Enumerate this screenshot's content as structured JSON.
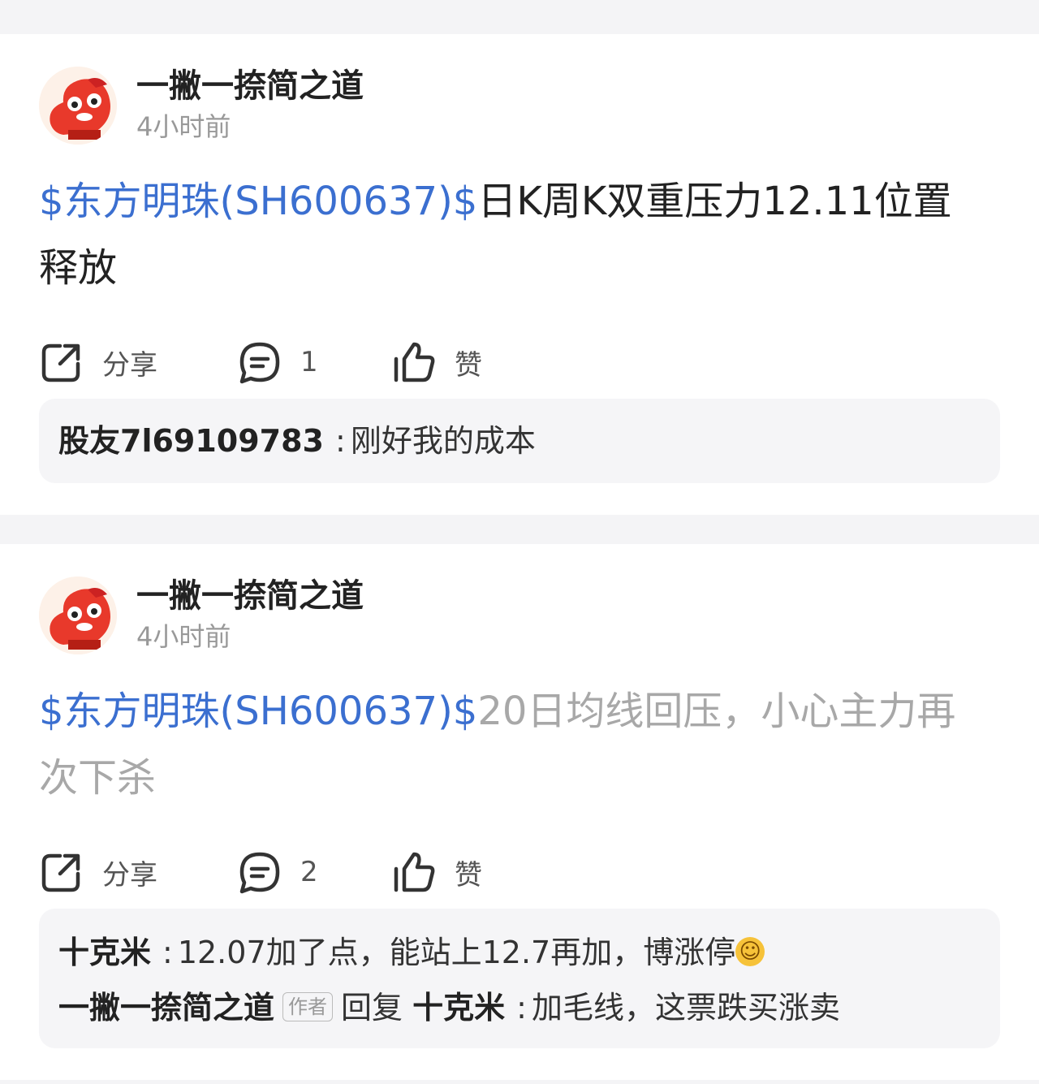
{
  "posts": [
    {
      "author": "一撇一捺简之道",
      "time": "4小时前",
      "stock_tag": "$东方明珠(SH600637)$",
      "text_line1": "日K周K双重压力12.11位置",
      "text_line2": "释放",
      "share_label": "分享",
      "comment_count": "1",
      "like_label": "赞",
      "comments": [
        {
          "user": "股友7l69109783",
          "sep": ":",
          "text": "刚好我的成本"
        }
      ]
    },
    {
      "author": "一撇一捺简之道",
      "time": "4小时前",
      "stock_tag": "$东方明珠(SH600637)$",
      "text_line1": "20日均线回压，小心主力再",
      "text_line2": "次下杀",
      "share_label": "分享",
      "comment_count": "2",
      "like_label": "赞",
      "comments": [
        {
          "user": "十克米",
          "sep": ":",
          "text": "12.07加了点，能站上12.7再加，博涨停",
          "emoji": "grin-emoji"
        },
        {
          "user": "一撇一捺简之道",
          "tag": "作者",
          "reply_word": "回复",
          "reply_to": "十克米",
          "sep": ":",
          "text": "加毛线，这票跌买涨卖"
        }
      ]
    }
  ],
  "colors": {
    "stock_link": "#3b6fd0",
    "faded_text": "#a8a8a8",
    "avatar_red": "#e8392b"
  }
}
